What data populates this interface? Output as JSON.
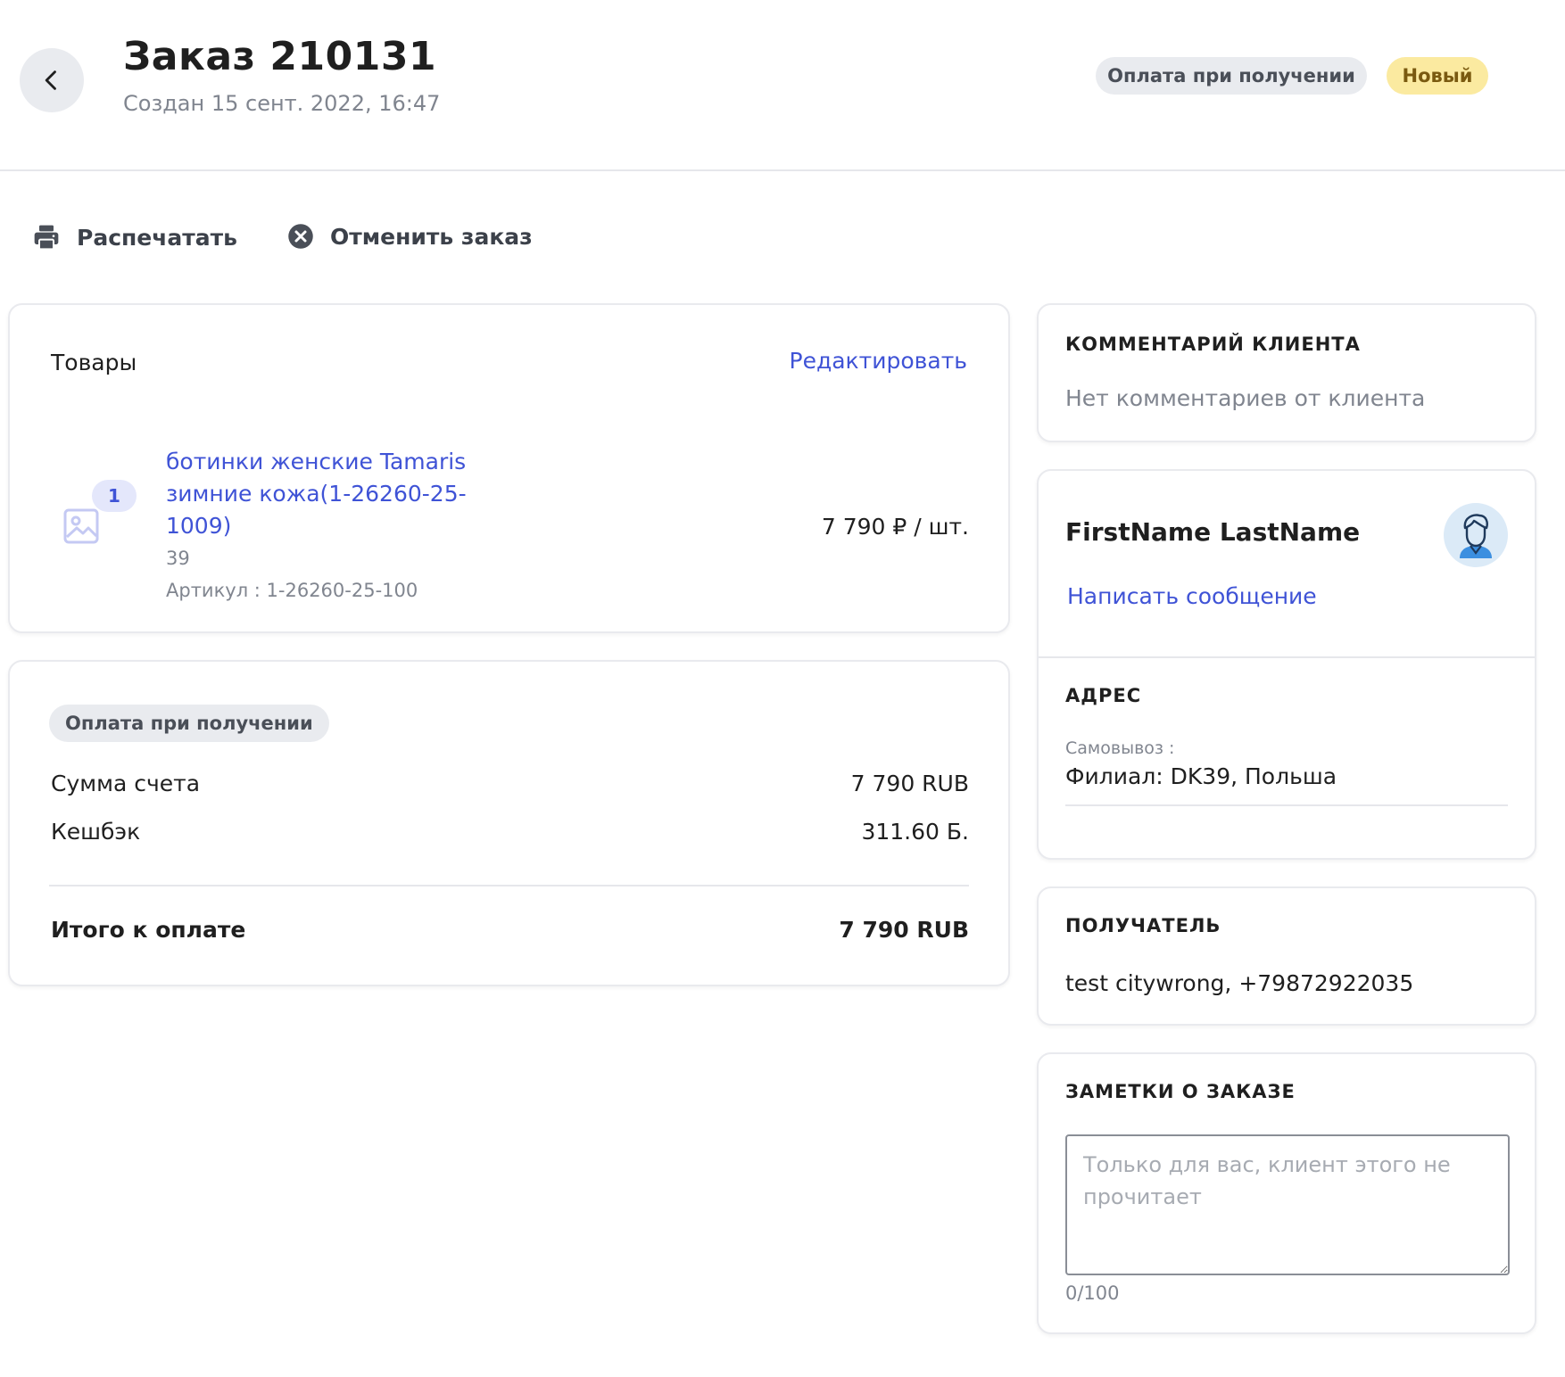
{
  "header": {
    "title": "Заказ 210131",
    "created": "Создан 15 сент. 2022, 16:47",
    "payment_badge": "Оплата при получении",
    "status_badge": "Новый"
  },
  "actions": {
    "print_label": "Распечатать",
    "cancel_label": "Отменить заказ"
  },
  "products": {
    "heading": "Товары",
    "edit_label": "Редактировать",
    "items": [
      {
        "quantity": "1",
        "name": "ботинки женские Tamaris зимние кожа(1-26260-25-1009)",
        "size": "39",
        "sku": "Артикул : 1-26260-25-100",
        "price": "7 790 ₽ / шт."
      }
    ]
  },
  "summary": {
    "payment_method": "Оплата при получении",
    "invoice_label": "Сумма счета",
    "invoice_value": "7 790 RUB",
    "cashback_label": "Кешбэк",
    "cashback_value": "311.60 Б.",
    "total_label": "Итого к оплате",
    "total_value": "7 790 RUB"
  },
  "comment": {
    "title": "КОММЕНТАРИЙ КЛИЕНТА",
    "text": "Нет комментариев от клиента"
  },
  "client": {
    "name": "FirstName LastName",
    "message_link": "Написать сообщение",
    "address_title": "АДРЕС",
    "pickup_label": "Самовывоз :",
    "address_value": "Филиал: DK39, Польша"
  },
  "recipient": {
    "title": "ПОЛУЧАТЕЛЬ",
    "value": "test citywrong, +79872922035"
  },
  "notes": {
    "title": "ЗАМЕТКИ О ЗАКАЗЕ",
    "placeholder": "Только для вас, клиент этого не прочитает",
    "value": "",
    "counter": "0/100"
  },
  "colors": {
    "accent": "#3f53d6",
    "status_bg": "#fbeaa0",
    "pill_bg": "#e9ebef"
  },
  "icons": {
    "back": "chevron-left-icon",
    "print": "printer-icon",
    "cancel": "close-circle-icon",
    "image": "image-placeholder-icon",
    "avatar": "user-avatar-icon"
  }
}
